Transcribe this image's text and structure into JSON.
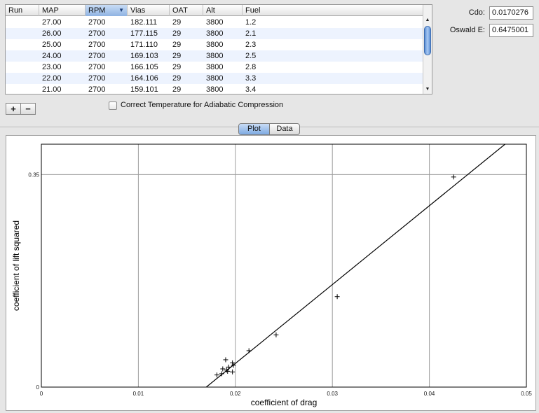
{
  "table": {
    "columns": [
      "Run",
      "MAP",
      "RPM",
      "Vias",
      "OAT",
      "Alt",
      "Fuel"
    ],
    "sorted_column": "RPM",
    "rows": [
      [
        "",
        "27.00",
        "2700",
        "182.111",
        "29",
        "3800",
        "1.2"
      ],
      [
        "",
        "26.00",
        "2700",
        "177.115",
        "29",
        "3800",
        "2.1"
      ],
      [
        "",
        "25.00",
        "2700",
        "171.110",
        "29",
        "3800",
        "2.3"
      ],
      [
        "",
        "24.00",
        "2700",
        "169.103",
        "29",
        "3800",
        "2.5"
      ],
      [
        "",
        "23.00",
        "2700",
        "166.105",
        "29",
        "3800",
        "2.8"
      ],
      [
        "",
        "22.00",
        "2700",
        "164.106",
        "29",
        "3800",
        "3.3"
      ],
      [
        "",
        "21.00",
        "2700",
        "159.101",
        "29",
        "3800",
        "3.4"
      ]
    ]
  },
  "params": {
    "cdo_label": "Cdo:",
    "cdo_value": "0.0170276",
    "oswald_label": "Oswald E:",
    "oswald_value": "0.6475001"
  },
  "controls": {
    "add_label": "+",
    "remove_label": "−",
    "checkbox_label": "Correct Temperature for Adiabatic Compression",
    "checkbox_checked": false
  },
  "tabs": {
    "plot": "Plot",
    "data": "Data",
    "active": "Plot"
  },
  "chart_data": {
    "type": "scatter",
    "title": "",
    "xlabel": "coefficient of drag",
    "ylabel": "coefficient of lift squared",
    "xlim": [
      0,
      0.05
    ],
    "ylim": [
      0,
      0.4
    ],
    "x_ticks": [
      0,
      0.01,
      0.02,
      0.03,
      0.04,
      0.05
    ],
    "x_tick_labels": [
      "0",
      "0.01",
      "0.02",
      "0.03",
      "0.04",
      "0.05"
    ],
    "y_ticks": [
      0,
      0.35
    ],
    "y_tick_labels": [
      "0",
      "0.35"
    ],
    "grid": true,
    "points": [
      {
        "x": 0.0425,
        "y": 0.346
      },
      {
        "x": 0.0305,
        "y": 0.149
      },
      {
        "x": 0.0242,
        "y": 0.086
      },
      {
        "x": 0.0214,
        "y": 0.06
      },
      {
        "x": 0.019,
        "y": 0.045
      },
      {
        "x": 0.0197,
        "y": 0.04
      },
      {
        "x": 0.0198,
        "y": 0.036
      },
      {
        "x": 0.0193,
        "y": 0.033
      },
      {
        "x": 0.0187,
        "y": 0.03
      },
      {
        "x": 0.0191,
        "y": 0.028
      },
      {
        "x": 0.0197,
        "y": 0.025
      },
      {
        "x": 0.0192,
        "y": 0.026
      },
      {
        "x": 0.0186,
        "y": 0.022
      },
      {
        "x": 0.0181,
        "y": 0.02
      }
    ],
    "fit_line": [
      {
        "x": 0.017,
        "y": 0.0
      },
      {
        "x": 0.0478,
        "y": 0.4
      }
    ]
  }
}
